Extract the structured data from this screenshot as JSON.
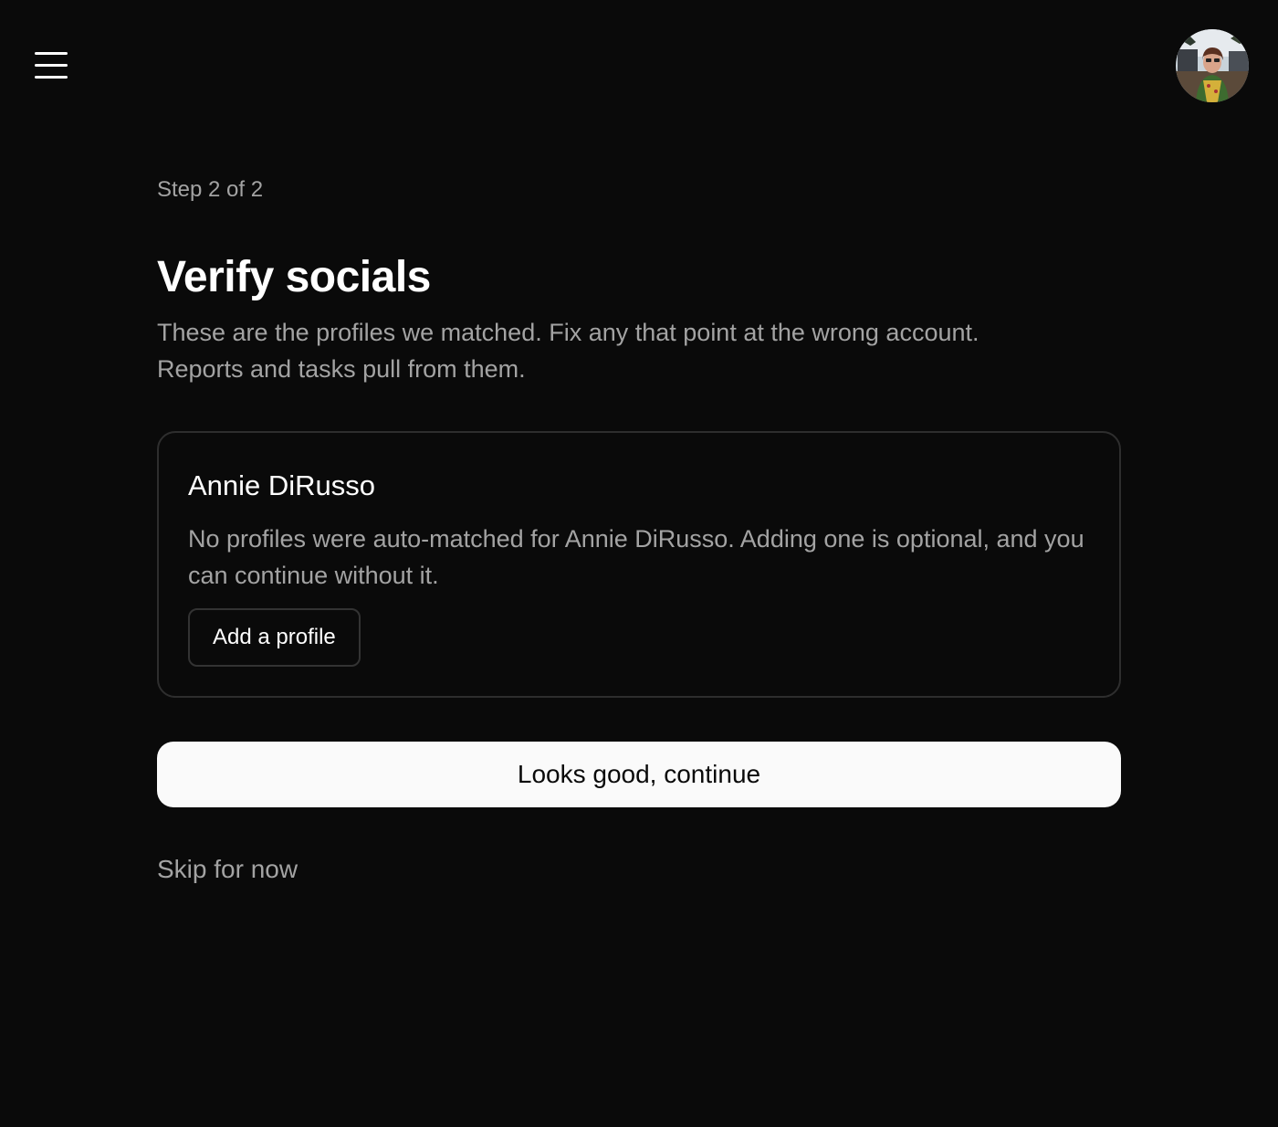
{
  "header": {
    "menu_icon": "hamburger-menu-icon",
    "avatar_icon": "user-avatar"
  },
  "onboarding": {
    "step_label": "Step 2 of 2",
    "title": "Verify socials",
    "subtitle": "These are the profiles we matched. Fix any that point at the wrong account. Reports and tasks pull from them."
  },
  "person_card": {
    "name": "Annie DiRusso",
    "message": "No profiles were auto-matched for Annie DiRusso. Adding one is optional, and you can continue without it.",
    "add_profile_label": "Add a profile"
  },
  "actions": {
    "continue_label": "Looks good, continue",
    "skip_label": "Skip for now"
  },
  "colors": {
    "background": "#0a0a0a",
    "text_primary": "#ffffff",
    "text_muted": "#a3a3a3",
    "card_border": "#2e2e2e",
    "primary_button_bg": "#fafafa",
    "primary_button_text": "#0a0a0a"
  }
}
